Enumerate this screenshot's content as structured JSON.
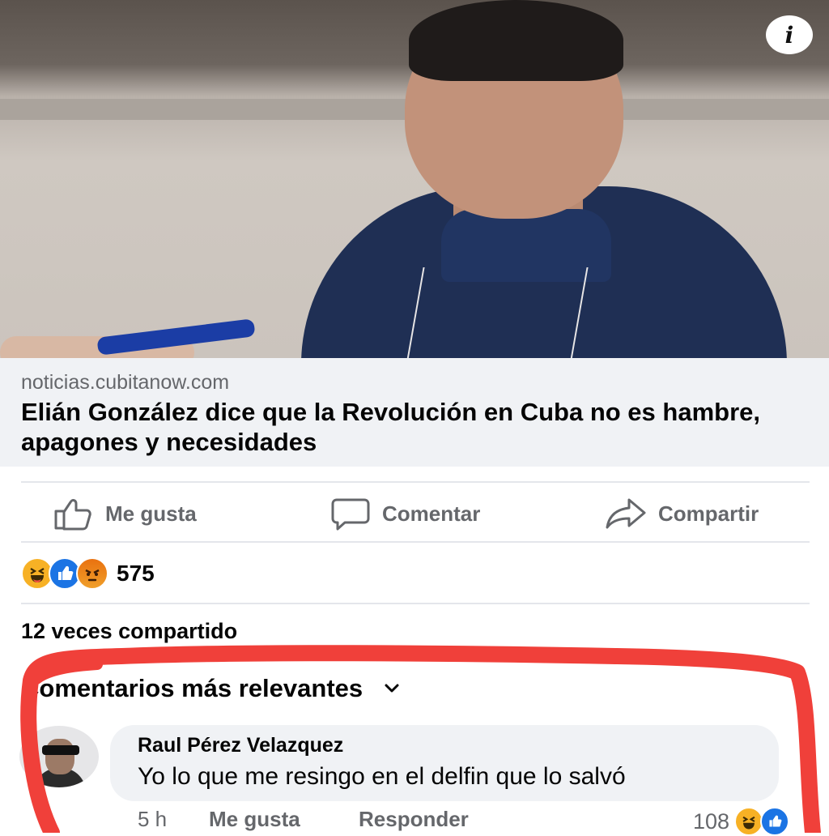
{
  "post": {
    "info_button": "i",
    "link": {
      "domain": "noticias.cubitanow.com",
      "headline": "Elián González dice que la Revolución en Cuba no es hambre, apagones y necesidades"
    },
    "actions": {
      "like": "Me gusta",
      "comment": "Comentar",
      "share": "Compartir"
    },
    "reactions": {
      "icons": [
        "haha-emoji-icon",
        "like-emoji-icon",
        "angry-emoji-icon"
      ],
      "count": "575"
    },
    "shares": "12 veces compartido"
  },
  "comments": {
    "sort_label": "Comentarios más relevantes",
    "items": [
      {
        "author": "Raul Pérez Velazquez",
        "text": "Yo lo que me resingo en el delfin que lo salvó",
        "time": "5 h",
        "like_label": "Me gusta",
        "reply_label": "Responder",
        "reaction_count": "108"
      }
    ]
  },
  "colors": {
    "link_bg": "#f0f2f5",
    "secondary_text": "#65676b",
    "like_blue": "#1b74e4",
    "annotation_red": "#f0403a"
  }
}
